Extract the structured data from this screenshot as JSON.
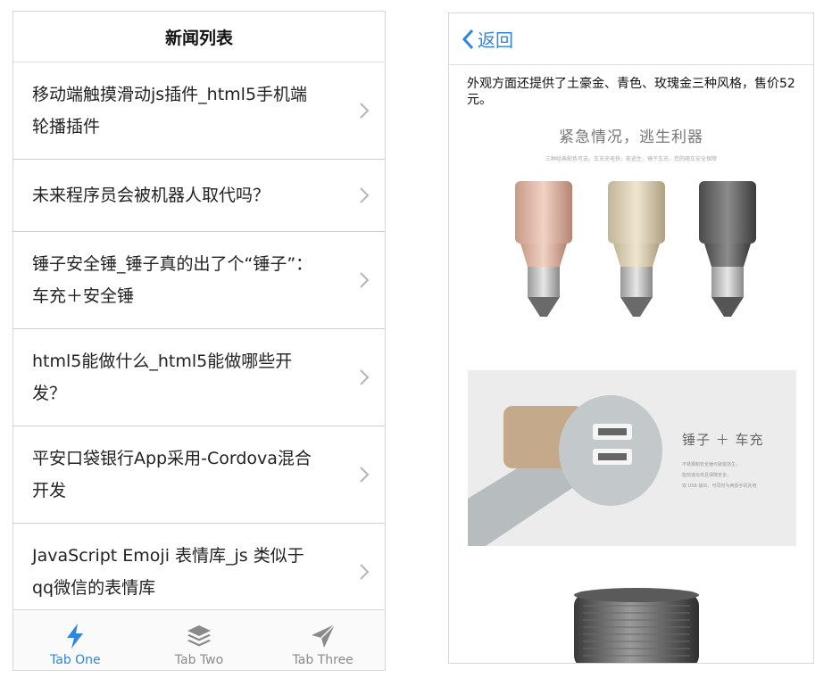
{
  "news": {
    "header_title": "新闻列表",
    "items": [
      {
        "line1": "移动端触摸滑动js插件_html5手机端",
        "line2": "轮播插件"
      },
      {
        "line1": "未来程序员会被机器人取代吗？",
        "line2": ""
      },
      {
        "line1": "锤子安全锤_锤子真的出了个“锤子”：",
        "line2": "车充＋安全锤"
      },
      {
        "line1": "html5能做什么_html5能做哪些开",
        "line2": "发？"
      },
      {
        "line1": "平安口袋银行App采用-Cordova混合",
        "line2": "开发"
      },
      {
        "line1": "JavaScript Emoji 表情库_js 类似于",
        "line2": "qq微信的表情库"
      }
    ],
    "tabs": [
      {
        "label": "Tab One",
        "icon": "lightning-icon"
      },
      {
        "label": "Tab Two",
        "icon": "layers-icon"
      },
      {
        "label": "Tab Three",
        "icon": "send-icon"
      }
    ],
    "active_tab": "Tab One",
    "accent_color": "#2e86de"
  },
  "detail": {
    "back_label": "返回",
    "intro_text": "外观方面还提供了土豪金、青色、玫瑰金三种风格，售价52元。",
    "promo1": {
      "headline": "紧急情况，逃生利器",
      "subline": "三种经典配色可选，车充充电快，能逃生，锤子车充，您的随车安全保障"
    },
    "promo2": {
      "title": "锤子 ＋ 车充",
      "desc_lines": [
        "不锈钢制安全锤可破窗逃生，",
        "能快速充电且保障安全，",
        "双 USB 输出，可同时为两部手机充电"
      ]
    }
  }
}
